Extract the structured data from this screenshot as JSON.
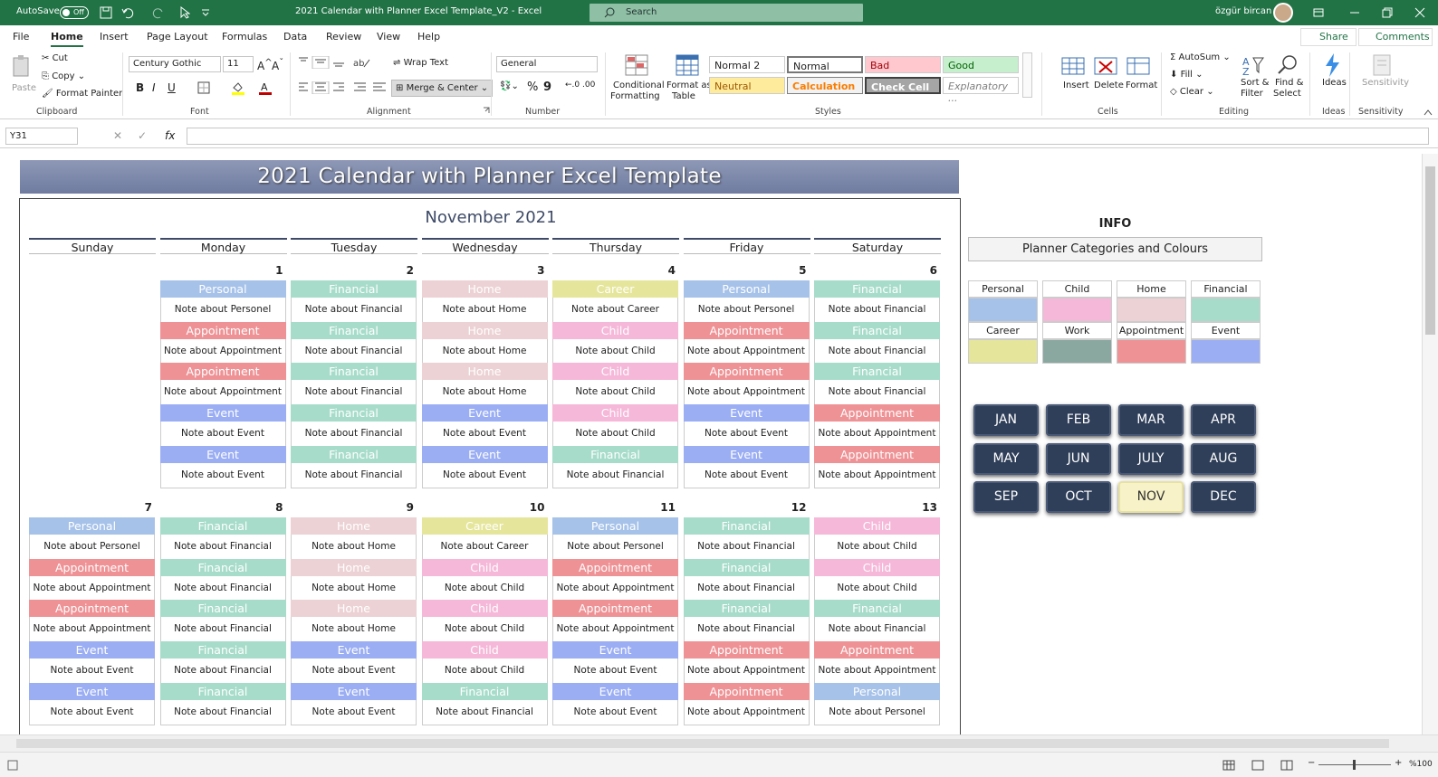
{
  "titlebar": {
    "autosave": "AutoSave",
    "toggle": "Off",
    "doc_title": "2021 Calendar with Planner Excel Template_V2  -  Excel",
    "search_placeholder": "Search",
    "user": "özgür bircan"
  },
  "menu": [
    "File",
    "Home",
    "Insert",
    "Page Layout",
    "Formulas",
    "Data",
    "Review",
    "View",
    "Help"
  ],
  "share": "Share",
  "comments": "Comments",
  "ribbon": {
    "clipboard": {
      "paste": "Paste",
      "cut": "Cut",
      "copy": "Copy",
      "format_painter": "Format Painter",
      "label": "Clipboard"
    },
    "font": {
      "name": "Century Gothic",
      "size": "11",
      "label": "Font",
      "bold": "B",
      "italic": "I",
      "underline": "U"
    },
    "alignment": {
      "wrap": "Wrap Text",
      "merge": "Merge & Center",
      "label": "Alignment"
    },
    "number": {
      "format": "General",
      "label": "Number",
      "pct": "%",
      "comma": "9"
    },
    "styles": {
      "cond": "Conditional",
      "cond2": "Formatting",
      "fmt_table": "Format as",
      "fmt_table2": "Table",
      "label": "Styles",
      "cells": [
        {
          "t": "Normal 2",
          "bg": "#ffffff",
          "c": "#000"
        },
        {
          "t": "Normal",
          "bg": "#ffffff",
          "c": "#000"
        },
        {
          "t": "Bad",
          "bg": "#ffc7ce",
          "c": "#9c0006"
        },
        {
          "t": "Good",
          "bg": "#c6efce",
          "c": "#006100"
        },
        {
          "t": "Neutral",
          "bg": "#ffeb9c",
          "c": "#9c5700"
        },
        {
          "t": "Calculation",
          "bg": "#f2f2f2",
          "c": "#fa7d00"
        },
        {
          "t": "Check Cell",
          "bg": "#a5a5a5",
          "c": "#ffffff"
        },
        {
          "t": "Explanatory ...",
          "bg": "#ffffff",
          "c": "#7f7f7f"
        }
      ]
    },
    "cells": {
      "insert": "Insert",
      "delete": "Delete",
      "format": "Format",
      "label": "Cells"
    },
    "editing": {
      "autosum": "AutoSum",
      "fill": "Fill",
      "clear": "Clear",
      "sort": "Sort &",
      "sort2": "Filter",
      "find": "Find &",
      "find2": "Select",
      "label": "Editing"
    },
    "ideas": {
      "btn": "Ideas",
      "label": "Ideas"
    },
    "sensitivity": {
      "btn": "Sensitivity",
      "label": "Sensitivity"
    }
  },
  "namebox": "Y31",
  "sheet": {
    "banner": "2021 Calendar with Planner Excel Template",
    "month": "November 2021",
    "days": [
      "Sunday",
      "Monday",
      "Tuesday",
      "Wednesday",
      "Thursday",
      "Friday",
      "Saturday"
    ],
    "colors": {
      "Personal": "#a6c2e9",
      "Financial": "#a7dcca",
      "Home": "#ecd2d4",
      "Career": "#e5e69c",
      "Child": "#f5b8d8",
      "Appointment": "#ee9295",
      "Event": "#9baef3",
      "Work": "#8aa8a0"
    },
    "week1": [
      {
        "num": "",
        "items": []
      },
      {
        "num": "1",
        "items": [
          "Personal",
          "Appointment",
          "Appointment",
          "Event",
          "Event"
        ],
        "notes": [
          "Note about Personel",
          "Note about Appointment",
          "Note about Appointment",
          "Note about Event",
          "Note about Event"
        ]
      },
      {
        "num": "2",
        "items": [
          "Financial",
          "Financial",
          "Financial",
          "Financial",
          "Financial"
        ],
        "notes": [
          "Note about Financial",
          "Note about Financial",
          "Note about Financial",
          "Note about Financial",
          "Note about Financial"
        ]
      },
      {
        "num": "3",
        "items": [
          "Home",
          "Home",
          "Home",
          "Event",
          "Event"
        ],
        "notes": [
          "Note about Home",
          "Note about Home",
          "Note about Home",
          "Note about Event",
          "Note about Event"
        ]
      },
      {
        "num": "4",
        "items": [
          "Career",
          "Child",
          "Child",
          "Child",
          "Financial"
        ],
        "notes": [
          "Note about Career",
          "Note about Child",
          "Note about Child",
          "Note about Child",
          "Note about Financial"
        ]
      },
      {
        "num": "5",
        "items": [
          "Personal",
          "Appointment",
          "Appointment",
          "Event",
          "Event"
        ],
        "notes": [
          "Note about Personel",
          "Note about Appointment",
          "Note about Appointment",
          "Note about Event",
          "Note about Event"
        ]
      },
      {
        "num": "6",
        "items": [
          "Financial",
          "Financial",
          "Financial",
          "Appointment",
          "Appointment"
        ],
        "notes": [
          "Note about Financial",
          "Note about Financial",
          "Note about Financial",
          "Note about Appointment",
          "Note about Appointment"
        ]
      }
    ],
    "week2": [
      {
        "num": "7",
        "items": [
          "Personal",
          "Appointment",
          "Appointment",
          "Event",
          "Event"
        ],
        "notes": [
          "Note about Personel",
          "Note about Appointment",
          "Note about Appointment",
          "Note about Event",
          "Note about Event"
        ]
      },
      {
        "num": "8",
        "items": [
          "Financial",
          "Financial",
          "Financial",
          "Financial",
          "Financial"
        ],
        "notes": [
          "Note about Financial",
          "Note about Financial",
          "Note about Financial",
          "Note about Financial",
          "Note about Financial"
        ]
      },
      {
        "num": "9",
        "items": [
          "Home",
          "Home",
          "Home",
          "Event",
          "Event"
        ],
        "notes": [
          "Note about Home",
          "Note about Home",
          "Note about Home",
          "Note about Event",
          "Note about Event"
        ]
      },
      {
        "num": "10",
        "items": [
          "Career",
          "Child",
          "Child",
          "Child",
          "Financial"
        ],
        "notes": [
          "Note about Career",
          "Note about Child",
          "Note about Child",
          "Note about Child",
          "Note about Financial"
        ]
      },
      {
        "num": "11",
        "items": [
          "Personal",
          "Appointment",
          "Appointment",
          "Event",
          "Event"
        ],
        "notes": [
          "Note about Personel",
          "Note about Appointment",
          "Note about Appointment",
          "Note about Event",
          "Note about Event"
        ]
      },
      {
        "num": "12",
        "items": [
          "Financial",
          "Financial",
          "Financial",
          "Appointment",
          "Appointment"
        ],
        "notes": [
          "Note about Financial",
          "Note about Financial",
          "Note about Financial",
          "Note about Appointment",
          "Note about Appointment"
        ]
      },
      {
        "num": "13",
        "items": [
          "Child",
          "Child",
          "Financial",
          "Appointment",
          "Personal"
        ],
        "notes": [
          "Note about Child",
          "Note about Child",
          "Note about Financial",
          "Note about Appointment",
          "Note about Personel"
        ]
      }
    ],
    "info": "INFO",
    "planner_title": "Planner Categories and Colours",
    "legend": [
      {
        "name": "Personal",
        "color": "#a6c2e9"
      },
      {
        "name": "Child",
        "color": "#f5b8d8"
      },
      {
        "name": "Home",
        "color": "#ecd2d4"
      },
      {
        "name": "Financial",
        "color": "#a7dcca"
      },
      {
        "name": "Career",
        "color": "#e5e69c"
      },
      {
        "name": "Work",
        "color": "#8aa8a0"
      },
      {
        "name": "Appointment",
        "color": "#ee9295"
      },
      {
        "name": "Event",
        "color": "#9baef3"
      }
    ],
    "months": [
      "JAN",
      "FEB",
      "MAR",
      "APR",
      "MAY",
      "JUN",
      "JULY",
      "AUG",
      "SEP",
      "OCT",
      "NOV",
      "DEC"
    ],
    "selected_month": "NOV"
  },
  "status": {
    "zoom": "%100"
  }
}
